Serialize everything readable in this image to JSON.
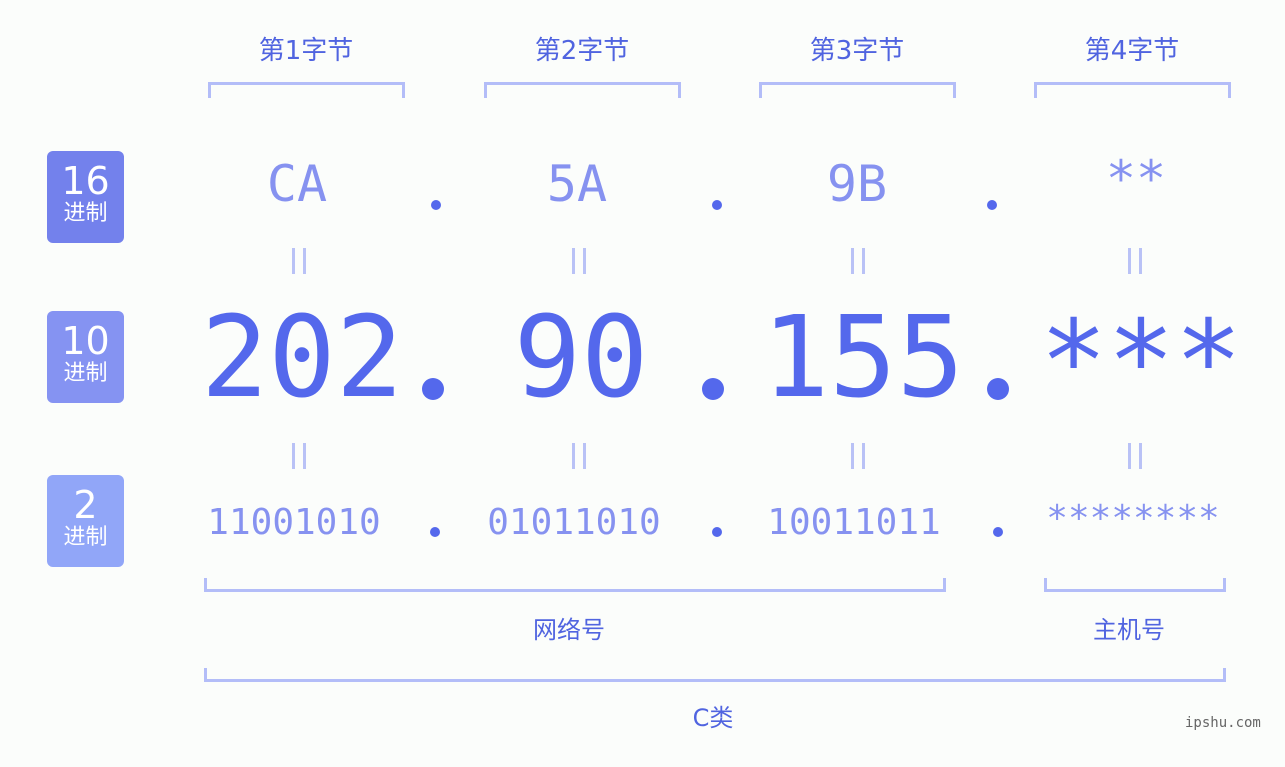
{
  "byte_labels": [
    "第1字节",
    "第2字节",
    "第3字节",
    "第4字节"
  ],
  "rows": {
    "hex": {
      "badge_number": "16",
      "badge_unit": "进制",
      "badge_color": "#7381ec",
      "values": [
        "CA",
        "5A",
        "9B",
        "**"
      ]
    },
    "dec": {
      "badge_number": "10",
      "badge_unit": "进制",
      "badge_color": "#8593f2",
      "values": [
        "202",
        "90",
        "155",
        "***"
      ]
    },
    "bin": {
      "badge_number": "2",
      "badge_unit": "进制",
      "badge_color": "#91a6f8",
      "values": [
        "11001010",
        "01011010",
        "10011011",
        "********"
      ]
    }
  },
  "separator": ".",
  "equals_symbol": "=",
  "sections": {
    "network": "网络号",
    "host": "主机号",
    "class": "C类"
  },
  "watermark": "ipshu.com",
  "colors": {
    "accent": "#5468ec",
    "light_accent": "#8692f0",
    "bracket": "#b3bdf8"
  }
}
